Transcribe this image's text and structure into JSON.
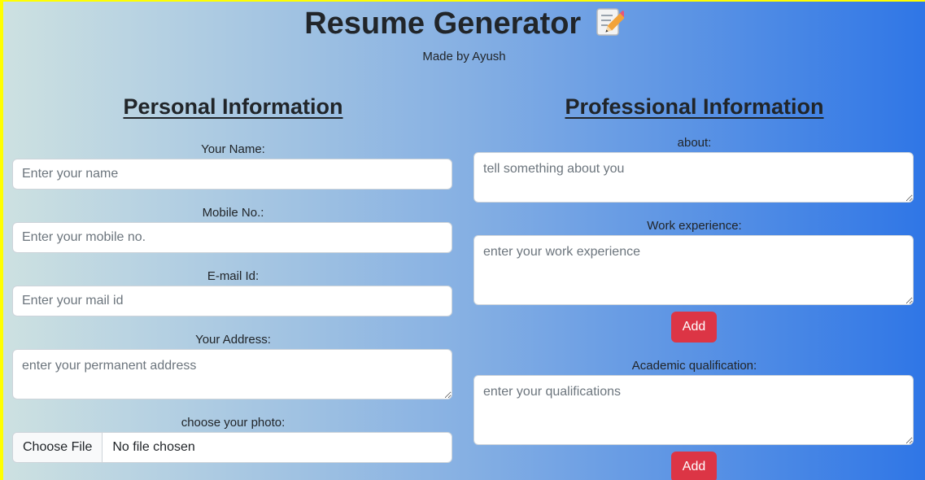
{
  "header": {
    "title": "Resume Generator",
    "title_icon": "memo-icon",
    "subtitle": "Made by Ayush"
  },
  "personal": {
    "heading": "Personal Information",
    "name_label": "Your Name:",
    "name_placeholder": "Enter your name",
    "mobile_label": "Mobile No.:",
    "mobile_placeholder": "Enter your mobile no.",
    "email_label": "E-mail Id:",
    "email_placeholder": "Enter your mail id",
    "address_label": "Your Address:",
    "address_placeholder": "enter your permanent address",
    "photo_label": "choose your photo:",
    "photo_button": "Choose File",
    "photo_status": "No file chosen"
  },
  "professional": {
    "heading": "Professional Information",
    "about_label": "about:",
    "about_placeholder": "tell something about you",
    "work_label": "Work experience:",
    "work_placeholder": "enter your work experience",
    "work_add": "Add",
    "academic_label": "Academic qualification:",
    "academic_placeholder": "enter your qualifications",
    "academic_add": "Add"
  },
  "colors": {
    "gradient_start": "#cde1e1",
    "gradient_end": "#2f76e6",
    "add_button": "#dc3545",
    "frame": "#ffff00"
  }
}
